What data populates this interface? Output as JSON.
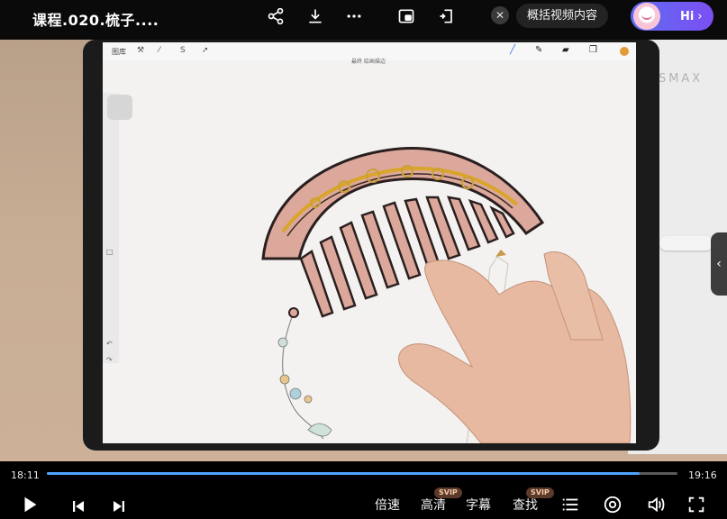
{
  "header": {
    "title": "课程.020.梳子....",
    "summary_button": "概括视频内容",
    "hi_button": "Hi",
    "close_label": "✕"
  },
  "video": {
    "app": {
      "gallery_label": "图库",
      "file_name": "最终 绘画描边"
    },
    "brand_text": "YSMAX"
  },
  "player": {
    "current_time": "18:11",
    "duration": "19:16",
    "progress_fraction": 0.94,
    "speed_label": "倍速",
    "quality_label": "高清",
    "quality_badge": "SVIP",
    "subtitle_label": "字幕",
    "search_label": "查找",
    "search_badge": "SVIP"
  },
  "colors": {
    "accent": "#4da3ff",
    "hi_gradient_start": "#5f6cf0",
    "hi_gradient_end": "#7c4ff3"
  }
}
